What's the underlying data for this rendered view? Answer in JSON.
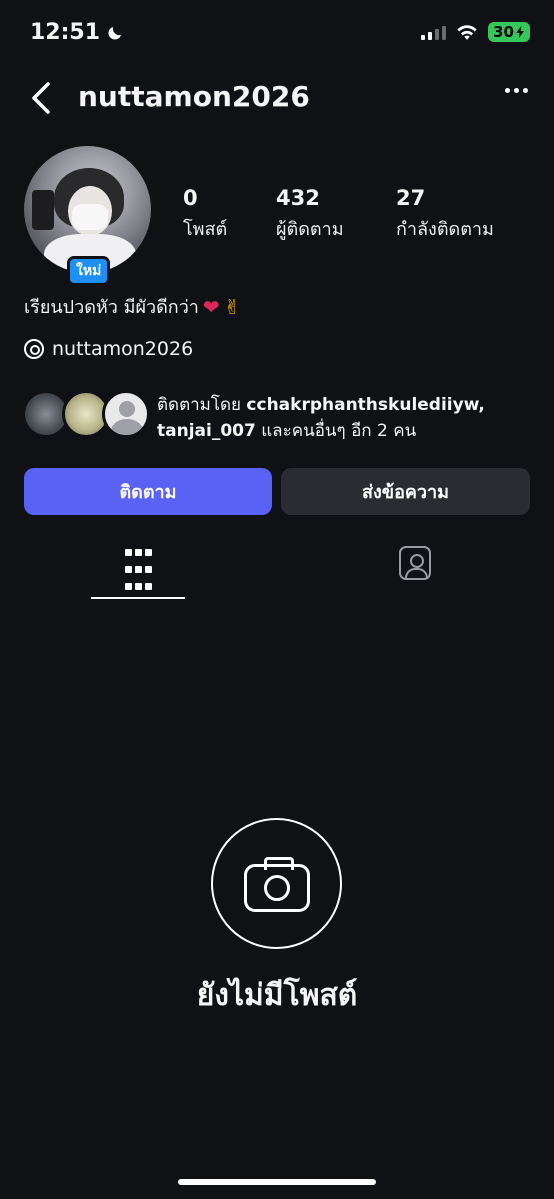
{
  "status_bar": {
    "time": "12:51",
    "battery": "30"
  },
  "header": {
    "username": "nuttamon2026"
  },
  "profile": {
    "new_badge": "ใหม่",
    "stats": [
      {
        "value": "0",
        "label": "โพสต์"
      },
      {
        "value": "432",
        "label": "ผู้ติดตาม"
      },
      {
        "value": "27",
        "label": "กำลังติดตาม"
      }
    ],
    "bio": "เรียนปวดหัว มีผัวดีกว่า",
    "threads_handle": "nuttamon2026",
    "followed_by": {
      "prefix": "ติดตามโดย",
      "users": "cchakrphanthskulediiyw, tanjai_007",
      "suffix": "และคนอื่นๆ อีก 2 คน"
    }
  },
  "actions": {
    "follow_label": "ติดตาม",
    "message_label": "ส่งข้อความ"
  },
  "tabs": [
    {
      "name": "posts-grid",
      "icon": "grid-icon",
      "active": true
    },
    {
      "name": "tagged",
      "icon": "tagged-person-icon",
      "active": false
    }
  ],
  "empty_state": {
    "icon": "camera-icon",
    "text": "ยังไม่มีโพสต์"
  },
  "colors": {
    "background": "#0f1115",
    "follow_button": "#5a62f5",
    "message_button": "#2a2c31",
    "badge": "#1d8ff5"
  }
}
